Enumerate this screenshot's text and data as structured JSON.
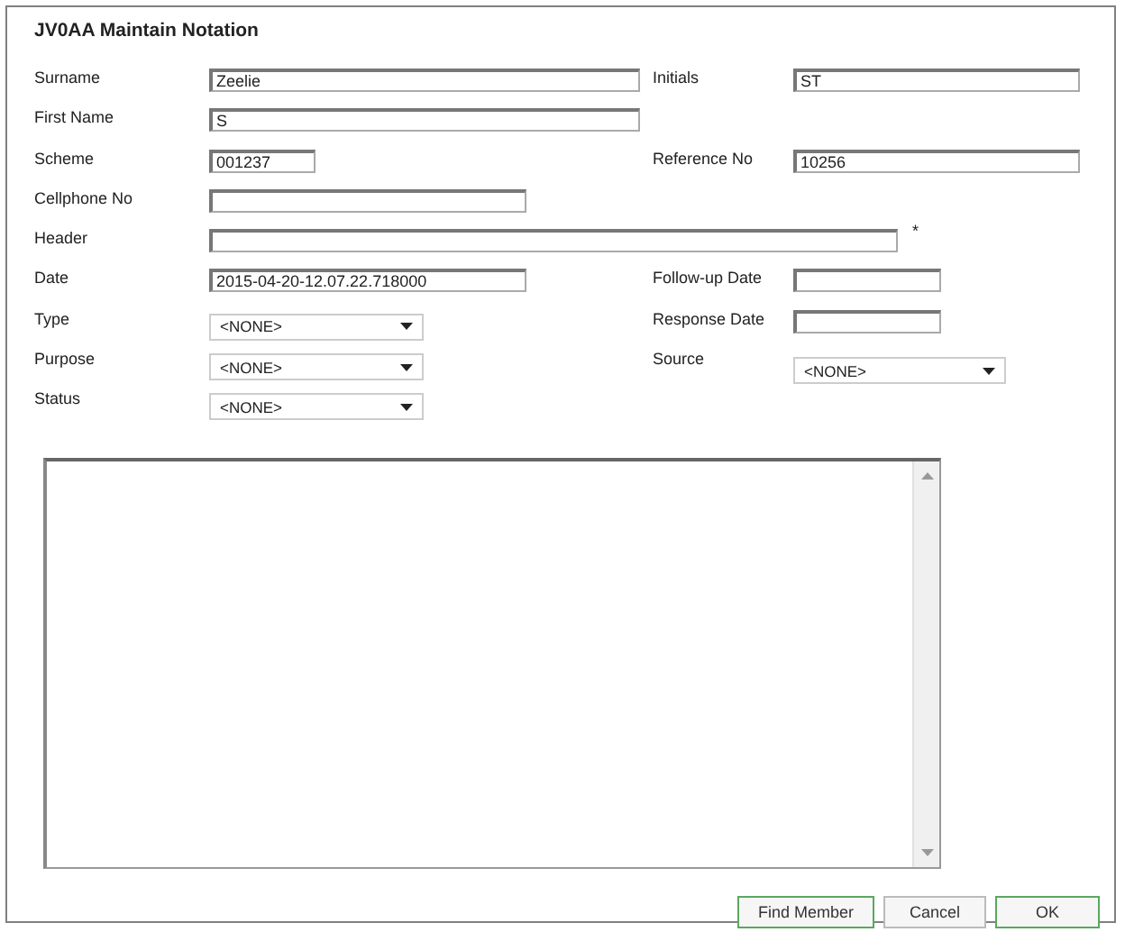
{
  "window": {
    "title": "JV0AA Maintain Notation"
  },
  "rows": [
    {
      "left": {
        "label": "Surname",
        "kind": "text",
        "value": "Zeelie"
      },
      "right": {
        "label": "Initials",
        "kind": "text",
        "value": "ST"
      }
    },
    {
      "left": {
        "label": "First Name",
        "kind": "text",
        "value": "S"
      }
    },
    {
      "left": {
        "label": "Scheme",
        "kind": "text",
        "value": "001237"
      },
      "right": {
        "label": "Reference No",
        "kind": "text",
        "value": "10256"
      }
    },
    {
      "left": {
        "label": "Cellphone No",
        "kind": "text"
      }
    },
    {
      "left": {
        "label": "Header",
        "kind": "text",
        "required_mark": "*"
      }
    },
    {
      "left": {
        "label": "Date",
        "kind": "text",
        "value": "2015-04-20-12.07.22.718000"
      },
      "right": {
        "label": "Follow-up Date",
        "kind": "text"
      }
    },
    {
      "left": {
        "label": "Type",
        "kind": "select",
        "value": "<NONE>"
      },
      "right": {
        "label": "Response Date",
        "kind": "text"
      }
    },
    {
      "left": {
        "label": "Purpose",
        "kind": "select",
        "value": "<NONE>"
      },
      "right": {
        "label": "Source",
        "kind": "select",
        "value": "<NONE>"
      }
    },
    {
      "left": {
        "label": "Status",
        "kind": "select",
        "value": "<NONE>"
      }
    }
  ],
  "buttons": [
    {
      "label": "Find Member",
      "kind": "accent"
    },
    {
      "label": "Cancel",
      "kind": "plain"
    },
    {
      "label": "OK",
      "kind": "accent"
    }
  ]
}
